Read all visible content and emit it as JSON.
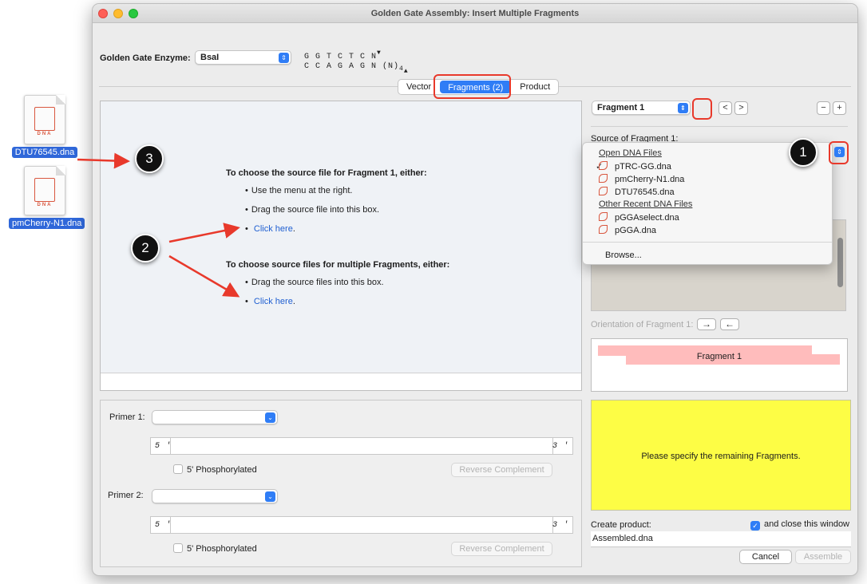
{
  "desktop": {
    "files": [
      {
        "label": "DTU76545.dna",
        "icon_text": "DNA"
      },
      {
        "label": "pmCherry-N1.dna",
        "icon_text": "DNA"
      }
    ]
  },
  "window": {
    "title": "Golden Gate Assembly: Insert Multiple Fragments"
  },
  "enzyme": {
    "label": "Golden Gate Enzyme:",
    "value": "BsaI",
    "site_top": "G G T C T C N",
    "site_bottom": "C C A G A G N (N)",
    "site_subscript": "4"
  },
  "tabs": [
    {
      "label": "Vector",
      "selected": false
    },
    {
      "label": "Fragments (2)",
      "selected": true
    },
    {
      "label": "Product",
      "selected": false
    }
  ],
  "instructions": {
    "single_heading": "To choose the source file for Fragment 1, either:",
    "single_items": [
      "Use the menu at the right.",
      "Drag the source file into this box."
    ],
    "single_link": "Click here",
    "multi_heading": "To choose source files for multiple Fragments, either:",
    "multi_items": [
      "Drag the source files into this box."
    ],
    "multi_link": "Click here",
    "period": "."
  },
  "primers": {
    "primer1_label": "Primer 1:",
    "primer2_label": "Primer 2:",
    "five_prime": "5 '",
    "three_prime": "3 '",
    "phosphorylated": "5' Phosphorylated",
    "reverse_complement": "Reverse Complement"
  },
  "fragment_selector": {
    "value": "Fragment 1",
    "prev": "<",
    "next": ">",
    "remove": "−",
    "add": "+"
  },
  "source": {
    "label": "Source of Fragment 1:",
    "open_header": "Open DNA Files",
    "open_files": [
      "pTRC-GG.dna",
      "pmCherry-N1.dna",
      "DTU76545.dna"
    ],
    "checked_index": 0,
    "recent_header": "Other Recent DNA Files",
    "recent_files": [
      "pGGAselect.dna",
      "pGGA.dna"
    ],
    "browse": "Browse...",
    "check_mark": "✓"
  },
  "orientation": {
    "label": "Orientation of Fragment 1:",
    "forward": "→",
    "reverse": "←"
  },
  "map": {
    "fragment_label": "Fragment 1"
  },
  "status": {
    "message": "Please specify the remaining Fragments."
  },
  "product": {
    "label": "Create product:",
    "close_label": "and close this window",
    "close_checked": true,
    "name": "Assembled.dna",
    "cancel": "Cancel",
    "assemble": "Assemble"
  },
  "callouts": [
    "1",
    "2",
    "3"
  ],
  "colors": {
    "accent": "#2f7df6",
    "highlight": "#e8392b",
    "status_bg": "#fdfd45",
    "fragment_fill": "#ffbcbc",
    "dna_icon": "#d9573f"
  }
}
